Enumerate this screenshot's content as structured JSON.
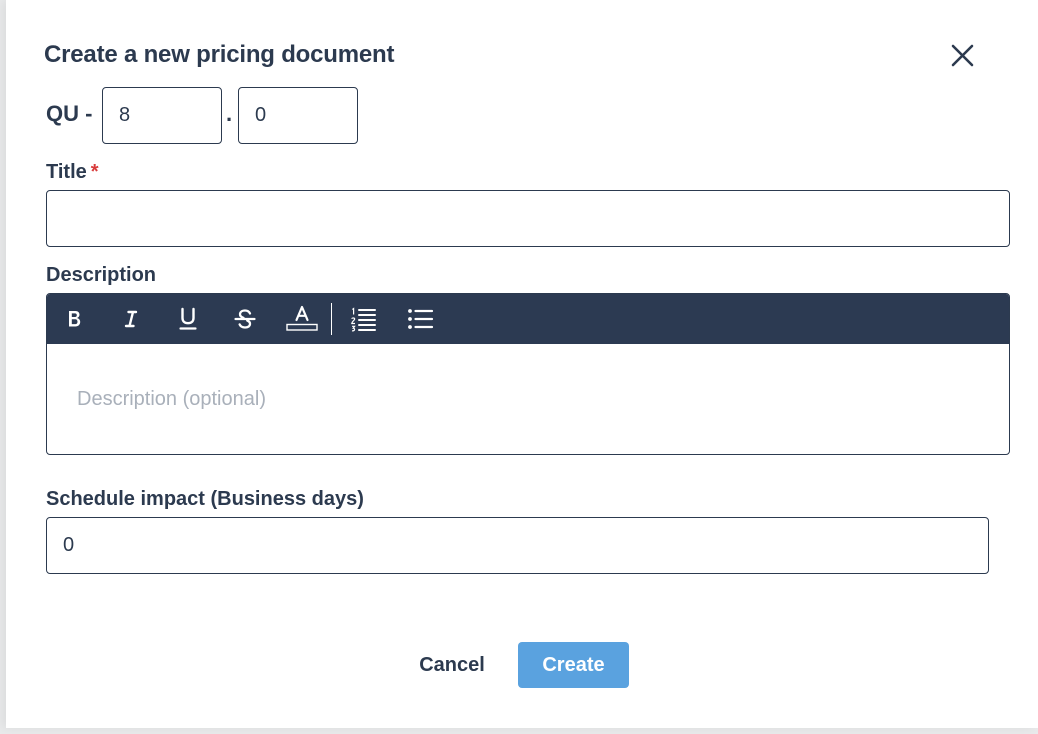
{
  "dialog": {
    "title": "Create a new pricing document",
    "close_icon": "close-icon"
  },
  "qu": {
    "prefix": "QU -",
    "major_value": "8",
    "separator": ".",
    "minor_value": "0"
  },
  "title_field": {
    "label": "Title",
    "required_marker": "*",
    "value": ""
  },
  "description": {
    "label": "Description",
    "placeholder": "Description (optional)",
    "toolbar": [
      {
        "name": "bold-icon",
        "tooltip": "Bold"
      },
      {
        "name": "italic-icon",
        "tooltip": "Italic"
      },
      {
        "name": "underline-icon",
        "tooltip": "Underline"
      },
      {
        "name": "strikethrough-icon",
        "tooltip": "Strikethrough"
      },
      {
        "name": "font-color-icon",
        "tooltip": "Font color"
      },
      {
        "name": "ordered-list-icon",
        "tooltip": "Ordered list"
      },
      {
        "name": "bullet-list-icon",
        "tooltip": "Bullet list"
      }
    ]
  },
  "schedule_impact": {
    "label": "Schedule impact (Business days)",
    "value": "0"
  },
  "actions": {
    "cancel_label": "Cancel",
    "create_label": "Create"
  },
  "colors": {
    "text": "#2c3a4f",
    "toolbar_bg": "#2c3a52",
    "primary_button": "#5aa2df",
    "required": "#d83b3b",
    "placeholder": "#a9b0ba"
  }
}
